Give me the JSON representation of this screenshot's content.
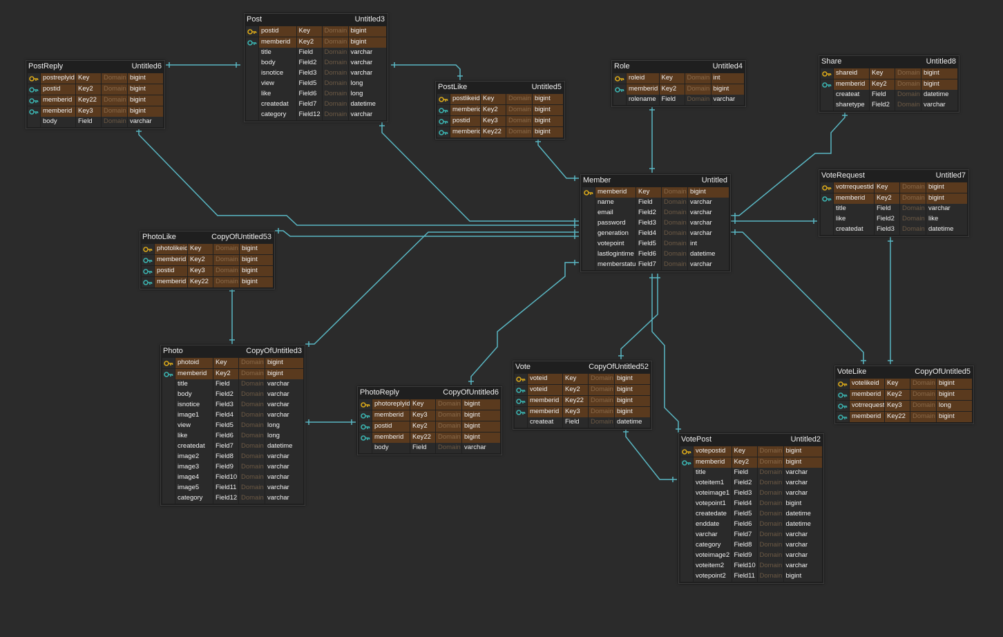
{
  "diagram": {
    "colors": {
      "background": "#2b2b2b",
      "table_bg": "#1f1f1f",
      "key_row": "#5a3a1e",
      "edge": "#5ab8c4",
      "primary_key_icon": "#d9a81a",
      "foreign_key_icon": "#3bb3b0"
    },
    "tables": [
      {
        "id": "post",
        "name": "Post",
        "alias": "Untitled3",
        "rows": [
          {
            "icon": "primary-key",
            "field": "postid",
            "key": "Key",
            "domain": "Domain",
            "type": "bigint"
          },
          {
            "icon": "foreign-key",
            "field": "memberid",
            "key": "Key2",
            "domain": "Domain",
            "type": "bigint"
          },
          {
            "icon": "",
            "field": "title",
            "key": "Field",
            "domain": "Domain",
            "type": "varchar"
          },
          {
            "icon": "",
            "field": "body",
            "key": "Field2",
            "domain": "Domain",
            "type": "varchar"
          },
          {
            "icon": "",
            "field": "isnotice",
            "key": "Field3",
            "domain": "Domain",
            "type": "varchar"
          },
          {
            "icon": "",
            "field": "view",
            "key": "Field5",
            "domain": "Domain",
            "type": "long"
          },
          {
            "icon": "",
            "field": "like",
            "key": "Field6",
            "domain": "Domain",
            "type": "long"
          },
          {
            "icon": "",
            "field": "createdat",
            "key": "Field7",
            "domain": "Domain",
            "type": "datetime"
          },
          {
            "icon": "",
            "field": "category",
            "key": "Field12",
            "domain": "Domain",
            "type": "varchar"
          }
        ]
      },
      {
        "id": "postreply",
        "name": "PostReply",
        "alias": "Untitled6",
        "rows": [
          {
            "icon": "primary-key",
            "field": "postreplyid",
            "key": "Key",
            "domain": "Domain",
            "type": "bigint"
          },
          {
            "icon": "foreign-key",
            "field": "postid",
            "key": "Key2",
            "domain": "Domain",
            "type": "bigint"
          },
          {
            "icon": "foreign-key",
            "field": "memberid",
            "key": "Key22",
            "domain": "Domain",
            "type": "bigint"
          },
          {
            "icon": "foreign-key",
            "field": "memberid",
            "key": "Key3",
            "domain": "Domain",
            "type": "bigint"
          },
          {
            "icon": "",
            "field": "body",
            "key": "Field",
            "domain": "Domain",
            "type": "varchar"
          }
        ]
      },
      {
        "id": "postlike",
        "name": "PostLike",
        "alias": "Untitled5",
        "rows": [
          {
            "icon": "primary-key",
            "field": "postlikeid",
            "key": "Key",
            "domain": "Domain",
            "type": "bigint"
          },
          {
            "icon": "foreign-key",
            "field": "memberid",
            "key": "Key2",
            "domain": "Domain",
            "type": "bigint"
          },
          {
            "icon": "foreign-key",
            "field": "postid",
            "key": "Key3",
            "domain": "Domain",
            "type": "bigint"
          },
          {
            "icon": "foreign-key",
            "field": "memberid",
            "key": "Key22",
            "domain": "Domain",
            "type": "bigint"
          }
        ]
      },
      {
        "id": "role",
        "name": "Role",
        "alias": "Untitled4",
        "rows": [
          {
            "icon": "primary-key",
            "field": "roleid",
            "key": "Key",
            "domain": "Domain",
            "type": "int"
          },
          {
            "icon": "foreign-key",
            "field": "memberid",
            "key": "Key2",
            "domain": "Domain",
            "type": "bigint"
          },
          {
            "icon": "",
            "field": "rolename",
            "key": "Field",
            "domain": "Domain",
            "type": "varchar"
          }
        ]
      },
      {
        "id": "share",
        "name": "Share",
        "alias": "Untitled8",
        "rows": [
          {
            "icon": "primary-key",
            "field": "shareid",
            "key": "Key",
            "domain": "Domain",
            "type": "bigint"
          },
          {
            "icon": "foreign-key",
            "field": "memberid",
            "key": "Key2",
            "domain": "Domain",
            "type": "bigint"
          },
          {
            "icon": "",
            "field": "createat",
            "key": "Field",
            "domain": "Domain",
            "type": "datetime"
          },
          {
            "icon": "",
            "field": "sharetype",
            "key": "Field2",
            "domain": "Domain",
            "type": "varchar"
          }
        ]
      },
      {
        "id": "member",
        "name": "Member",
        "alias": "Untitled",
        "rows": [
          {
            "icon": "primary-key",
            "field": "memberid",
            "key": "Key",
            "domain": "Domain",
            "type": "bigint"
          },
          {
            "icon": "",
            "field": "name",
            "key": "Field",
            "domain": "Domain",
            "type": "varchar"
          },
          {
            "icon": "",
            "field": "email",
            "key": "Field2",
            "domain": "Domain",
            "type": "varchar"
          },
          {
            "icon": "",
            "field": "password",
            "key": "Field3",
            "domain": "Domain",
            "type": "varchar"
          },
          {
            "icon": "",
            "field": "generation",
            "key": "Field4",
            "domain": "Domain",
            "type": "varchar"
          },
          {
            "icon": "",
            "field": "votepoint",
            "key": "Field5",
            "domain": "Domain",
            "type": "int"
          },
          {
            "icon": "",
            "field": "lastlogintime",
            "key": "Field6",
            "domain": "Domain",
            "type": "datetime"
          },
          {
            "icon": "",
            "field": "memberstatus",
            "key": "Field7",
            "domain": "Domain",
            "type": "varchar"
          }
        ]
      },
      {
        "id": "voterequest",
        "name": "VoteRequest",
        "alias": "Untitled7",
        "rows": [
          {
            "icon": "primary-key",
            "field": "votrrequestid",
            "key": "Key",
            "domain": "Domain",
            "type": "bigint"
          },
          {
            "icon": "foreign-key",
            "field": "memberid",
            "key": "Key2",
            "domain": "Domain",
            "type": "bigint"
          },
          {
            "icon": "",
            "field": "title",
            "key": "Field",
            "domain": "Domain",
            "type": "varchar"
          },
          {
            "icon": "",
            "field": "like",
            "key": "Field2",
            "domain": "Domain",
            "type": "like"
          },
          {
            "icon": "",
            "field": "createdat",
            "key": "Field3",
            "domain": "Domain",
            "type": "datetime"
          }
        ]
      },
      {
        "id": "photolike",
        "name": "PhotoLike",
        "alias": "CopyOfUntitled53",
        "rows": [
          {
            "icon": "primary-key",
            "field": "photolikeid",
            "key": "Key",
            "domain": "Domain",
            "type": "bigint"
          },
          {
            "icon": "foreign-key",
            "field": "memberid",
            "key": "Key2",
            "domain": "Domain",
            "type": "bigint"
          },
          {
            "icon": "foreign-key",
            "field": "postid",
            "key": "Key3",
            "domain": "Domain",
            "type": "bigint"
          },
          {
            "icon": "foreign-key",
            "field": "memberid",
            "key": "Key22",
            "domain": "Domain",
            "type": "bigint"
          }
        ]
      },
      {
        "id": "photo",
        "name": "Photo",
        "alias": "CopyOfUntitled3",
        "rows": [
          {
            "icon": "primary-key",
            "field": "photoid",
            "key": "Key",
            "domain": "Domain",
            "type": "bigint"
          },
          {
            "icon": "foreign-key",
            "field": "memberid",
            "key": "Key2",
            "domain": "Domain",
            "type": "bigint"
          },
          {
            "icon": "",
            "field": "title",
            "key": "Field",
            "domain": "Domain",
            "type": "varchar"
          },
          {
            "icon": "",
            "field": "body",
            "key": "Field2",
            "domain": "Domain",
            "type": "varchar"
          },
          {
            "icon": "",
            "field": "isnotice",
            "key": "Field3",
            "domain": "Domain",
            "type": "varchar"
          },
          {
            "icon": "",
            "field": "image1",
            "key": "Field4",
            "domain": "Domain",
            "type": "varchar"
          },
          {
            "icon": "",
            "field": "view",
            "key": "Field5",
            "domain": "Domain",
            "type": "long"
          },
          {
            "icon": "",
            "field": "like",
            "key": "Field6",
            "domain": "Domain",
            "type": "long"
          },
          {
            "icon": "",
            "field": "createdat",
            "key": "Field7",
            "domain": "Domain",
            "type": "datetime"
          },
          {
            "icon": "",
            "field": "image2",
            "key": "Field8",
            "domain": "Domain",
            "type": "varchar"
          },
          {
            "icon": "",
            "field": "image3",
            "key": "Field9",
            "domain": "Domain",
            "type": "varchar"
          },
          {
            "icon": "",
            "field": "image4",
            "key": "Field10",
            "domain": "Domain",
            "type": "varchar"
          },
          {
            "icon": "",
            "field": "image5",
            "key": "Field11",
            "domain": "Domain",
            "type": "varchar"
          },
          {
            "icon": "",
            "field": "category",
            "key": "Field12",
            "domain": "Domain",
            "type": "varchar"
          }
        ]
      },
      {
        "id": "photoreply",
        "name": "PhotoReply",
        "alias": "CopyOfUntitled6",
        "rows": [
          {
            "icon": "primary-key",
            "field": "photoreplyid",
            "key": "Key",
            "domain": "Domain",
            "type": "bigint"
          },
          {
            "icon": "foreign-key",
            "field": "memberid",
            "key": "Key3",
            "domain": "Domain",
            "type": "bigint"
          },
          {
            "icon": "foreign-key",
            "field": "postid",
            "key": "Key2",
            "domain": "Domain",
            "type": "bigint"
          },
          {
            "icon": "foreign-key",
            "field": "memberid",
            "key": "Key22",
            "domain": "Domain",
            "type": "bigint"
          },
          {
            "icon": "",
            "field": "body",
            "key": "Field",
            "domain": "Domain",
            "type": "varchar"
          }
        ]
      },
      {
        "id": "vote",
        "name": "Vote",
        "alias": "CopyOfUntitled52",
        "rows": [
          {
            "icon": "primary-key",
            "field": "voteid",
            "key": "Key",
            "domain": "Domain",
            "type": "bigint"
          },
          {
            "icon": "foreign-key",
            "field": "voteid",
            "key": "Key2",
            "domain": "Domain",
            "type": "bigint"
          },
          {
            "icon": "foreign-key",
            "field": "memberid",
            "key": "Key22",
            "domain": "Domain",
            "type": "bigint"
          },
          {
            "icon": "foreign-key",
            "field": "memberid",
            "key": "Key3",
            "domain": "Domain",
            "type": "bigint"
          },
          {
            "icon": "",
            "field": "createat",
            "key": "Field",
            "domain": "Domain",
            "type": "datetime"
          }
        ]
      },
      {
        "id": "votepost",
        "name": "VotePost",
        "alias": "Untitled2",
        "rows": [
          {
            "icon": "primary-key",
            "field": "votepostid",
            "key": "Key",
            "domain": "Domain",
            "type": "bigint"
          },
          {
            "icon": "foreign-key",
            "field": "memberid",
            "key": "Key2",
            "domain": "Domain",
            "type": "bigint"
          },
          {
            "icon": "",
            "field": "title",
            "key": "Field",
            "domain": "Domain",
            "type": "varchar"
          },
          {
            "icon": "",
            "field": "voteitem1",
            "key": "Field2",
            "domain": "Domain",
            "type": "varchar"
          },
          {
            "icon": "",
            "field": "voteimage1",
            "key": "Field3",
            "domain": "Domain",
            "type": "varchar"
          },
          {
            "icon": "",
            "field": "votepoint1",
            "key": "Field4",
            "domain": "Domain",
            "type": "bigint"
          },
          {
            "icon": "",
            "field": "createdate",
            "key": "Field5",
            "domain": "Domain",
            "type": "datetime"
          },
          {
            "icon": "",
            "field": "enddate",
            "key": "Field6",
            "domain": "Domain",
            "type": "datetime"
          },
          {
            "icon": "",
            "field": "varchar",
            "key": "Field7",
            "domain": "Domain",
            "type": "varchar"
          },
          {
            "icon": "",
            "field": "category",
            "key": "Field8",
            "domain": "Domain",
            "type": "varchar"
          },
          {
            "icon": "",
            "field": "voteimage2",
            "key": "Field9",
            "domain": "Domain",
            "type": "varchar"
          },
          {
            "icon": "",
            "field": "voteitem2",
            "key": "Field10",
            "domain": "Domain",
            "type": "varchar"
          },
          {
            "icon": "",
            "field": "votepoint2",
            "key": "Field11",
            "domain": "Domain",
            "type": "bigint"
          }
        ]
      },
      {
        "id": "votelike",
        "name": "VoteLike",
        "alias": "CopyOfUntitled5",
        "rows": [
          {
            "icon": "primary-key",
            "field": "votelikeid",
            "key": "Key",
            "domain": "Domain",
            "type": "bigint"
          },
          {
            "icon": "foreign-key",
            "field": "memberid",
            "key": "Key2",
            "domain": "Domain",
            "type": "bigint"
          },
          {
            "icon": "foreign-key",
            "field": "votrrequestid",
            "key": "Key3",
            "domain": "Domain",
            "type": "long"
          },
          {
            "icon": "foreign-key",
            "field": "memberid",
            "key": "Key22",
            "domain": "Domain",
            "type": "bigint"
          }
        ]
      }
    ],
    "relationships": [
      {
        "from": "postreply",
        "to": "post"
      },
      {
        "from": "post",
        "to": "postlike"
      },
      {
        "from": "postlike",
        "to": "member"
      },
      {
        "from": "role",
        "to": "member"
      },
      {
        "from": "share",
        "to": "member"
      },
      {
        "from": "postreply",
        "to": "member"
      },
      {
        "from": "post",
        "to": "member"
      },
      {
        "from": "photolike",
        "to": "member"
      },
      {
        "from": "photo",
        "to": "member"
      },
      {
        "from": "photolike",
        "to": "photo"
      },
      {
        "from": "photo",
        "to": "photoreply"
      },
      {
        "from": "photoreply",
        "to": "member"
      },
      {
        "from": "vote",
        "to": "member"
      },
      {
        "from": "votepost",
        "to": "member"
      },
      {
        "from": "vote",
        "to": "votepost"
      },
      {
        "from": "voterequest",
        "to": "member"
      },
      {
        "from": "votelike",
        "to": "member"
      },
      {
        "from": "votelike",
        "to": "voterequest"
      }
    ]
  }
}
